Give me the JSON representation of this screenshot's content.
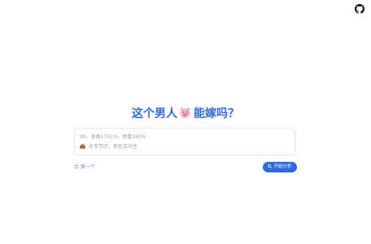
{
  "header": {
    "github_icon": "github-icon"
  },
  "main": {
    "title_prefix": "这个男人",
    "title_emoji": "pig-face-icon",
    "title_suffix": "能嫁吗？",
    "input": {
      "line1": "99，身高173cm，体重160斤",
      "line2_icon": "briefcase-icon",
      "line2": "大专学历，担任车间主"
    },
    "change_button": {
      "icon": "refresh-icon",
      "label": "换一个"
    },
    "analyze_button": {
      "icon": "search-icon",
      "label": "开始分析"
    }
  },
  "colors": {
    "accent": "#2f69e6",
    "link": "#6f8fd8",
    "placeholder": "#9aa0a6",
    "border": "#e3e6ea"
  }
}
